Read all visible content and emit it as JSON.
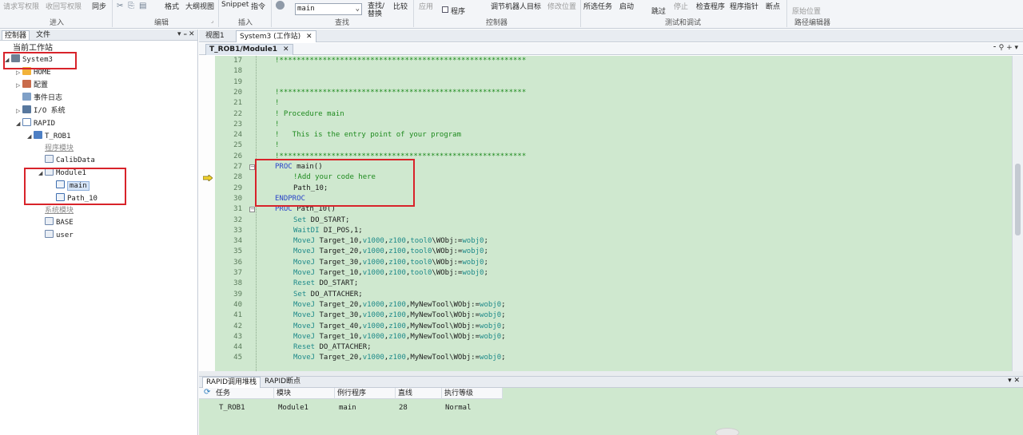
{
  "ribbon": {
    "items": {
      "request_write": "请求写权限",
      "release_write": "收回写权限",
      "sync": "同步",
      "format": "格式",
      "outline_view": "大纲视图",
      "snippet": "Snippet",
      "instruction": "指令",
      "search_value": "main",
      "find_replace_1": "查找/",
      "find_replace_2": "替换",
      "compare": "比较",
      "apply": "应用",
      "program": "程序",
      "jog_robot_target": "调节机器人目标",
      "modify_position": "修改位置",
      "selected_task": "所选任务",
      "start": "启动",
      "skip": "跳过",
      "stop": "停止",
      "check_program": "检查程序",
      "program_pointer": "程序指针",
      "breakpoint": "断点",
      "origin_position": "原始位置"
    },
    "groups": {
      "enter": "进入",
      "edit": "编辑",
      "insert": "插入",
      "find": "查找",
      "controller": "控制器",
      "test_debug": "测试和调试",
      "path_editor": "路径编辑器"
    }
  },
  "left_panel": {
    "tab_controller": "控制器",
    "tab_file": "文件",
    "pin": "▾ ₌",
    "close": "✕",
    "tree": {
      "current_station": "当前工作站",
      "system": "System3",
      "home": "HOME",
      "config": "配置",
      "event_log": "事件日志",
      "io_system": "I/O 系统",
      "rapid": "RAPID",
      "task": "T_ROB1",
      "program_modules": "程序模块",
      "calibdata": "CalibData",
      "module1": "Module1",
      "main": "main",
      "path_10": "Path_10",
      "system_modules": "系统模块",
      "base": "BASE",
      "user": "user"
    }
  },
  "doc_tabs": {
    "view1": "视图1",
    "system3_station": "System3 (工作站)",
    "close": "✕"
  },
  "editor_tab": {
    "label": "T_ROB1/Module1",
    "close": "✕",
    "controls": "⁃ ⚲ + ▾"
  },
  "code_lines": [
    {
      "n": "17",
      "text": "!*********************************************************",
      "cls": "c-comment",
      "indent": 0
    },
    {
      "n": "18",
      "text": "",
      "cls": "c-plain",
      "indent": 0
    },
    {
      "n": "19",
      "text": "",
      "cls": "c-plain",
      "indent": 0
    },
    {
      "n": "20",
      "text": "!*********************************************************",
      "cls": "c-comment",
      "indent": 0
    },
    {
      "n": "21",
      "text": "!",
      "cls": "c-comment",
      "indent": 0
    },
    {
      "n": "22",
      "text": "! Procedure main",
      "cls": "c-comment",
      "indent": 0
    },
    {
      "n": "23",
      "text": "!",
      "cls": "c-comment",
      "indent": 0
    },
    {
      "n": "24",
      "text": "!   This is the entry point of your program",
      "cls": "c-comment",
      "indent": 0
    },
    {
      "n": "25",
      "text": "!",
      "cls": "c-comment",
      "indent": 0
    },
    {
      "n": "26",
      "text": "!*********************************************************",
      "cls": "c-comment",
      "indent": 0
    },
    {
      "n": "27",
      "text": "PROC main()",
      "cls": "c-kw-mixed",
      "indent": 0
    },
    {
      "n": "28",
      "text": "!Add your code here",
      "cls": "c-comment",
      "indent": 1
    },
    {
      "n": "29",
      "text": "Path_10;",
      "cls": "c-plain",
      "indent": 1
    },
    {
      "n": "30",
      "text": "ENDPROC",
      "cls": "c-kw",
      "indent": 0
    },
    {
      "n": "31",
      "text": "PROC Path_10()",
      "cls": "c-kw-mixed",
      "indent": 0
    },
    {
      "n": "32",
      "text": "Set DO_START;",
      "cls": "c-kwstmt",
      "indent": 1
    },
    {
      "n": "33",
      "text": "WaitDI DI_POS,1;",
      "cls": "c-kwstmt",
      "indent": 1
    },
    {
      "n": "34",
      "text": "MoveJ Target_10,v1000,z100,tool0\\WObj:=wobj0;",
      "cls": "c-move",
      "indent": 1
    },
    {
      "n": "35",
      "text": "MoveJ Target_20,v1000,z100,tool0\\WObj:=wobj0;",
      "cls": "c-move",
      "indent": 1
    },
    {
      "n": "36",
      "text": "MoveJ Target_30,v1000,z100,tool0\\WObj:=wobj0;",
      "cls": "c-move",
      "indent": 1
    },
    {
      "n": "37",
      "text": "MoveJ Target_10,v1000,z100,tool0\\WObj:=wobj0;",
      "cls": "c-move",
      "indent": 1
    },
    {
      "n": "38",
      "text": "Reset DO_START;",
      "cls": "c-kwstmt",
      "indent": 1
    },
    {
      "n": "39",
      "text": "Set DO_ATTACHER;",
      "cls": "c-kwstmt",
      "indent": 1
    },
    {
      "n": "40",
      "text": "MoveJ Target_20,v1000,z100,MyNewTool\\WObj:=wobj0;",
      "cls": "c-move",
      "indent": 1
    },
    {
      "n": "41",
      "text": "MoveJ Target_30,v1000,z100,MyNewTool\\WObj:=wobj0;",
      "cls": "c-move",
      "indent": 1
    },
    {
      "n": "42",
      "text": "MoveJ Target_40,v1000,z100,MyNewTool\\WObj:=wobj0;",
      "cls": "c-move",
      "indent": 1
    },
    {
      "n": "43",
      "text": "MoveJ Target_10,v1000,z100,MyNewTool\\WObj:=wobj0;",
      "cls": "c-move",
      "indent": 1
    },
    {
      "n": "44",
      "text": "Reset DO_ATTACHER;",
      "cls": "c-kwstmt",
      "indent": 1
    },
    {
      "n": "45",
      "text": "MoveJ Target_20,v1000,z100,MyNewTool\\WObj:=wobj0;",
      "cls": "c-move",
      "indent": 1
    }
  ],
  "bottom": {
    "tab_callstack": "RAPID调用堆栈",
    "tab_breakpoints": "RAPID断点",
    "controls": "▾ ✕",
    "headers": {
      "task": "任务",
      "module": "模块",
      "routine": "例行程序",
      "line": "直线",
      "exec_level": "执行等级"
    },
    "row": {
      "task": "T_ROB1",
      "module": "Module1",
      "routine": "main",
      "line": "28",
      "exec_level": "Normal"
    }
  },
  "colors": {
    "editor_bg": "#cfe8cf",
    "comment": "#1e8a1e",
    "keyword": "#2a44c8",
    "annotation_red": "#d8232a"
  }
}
